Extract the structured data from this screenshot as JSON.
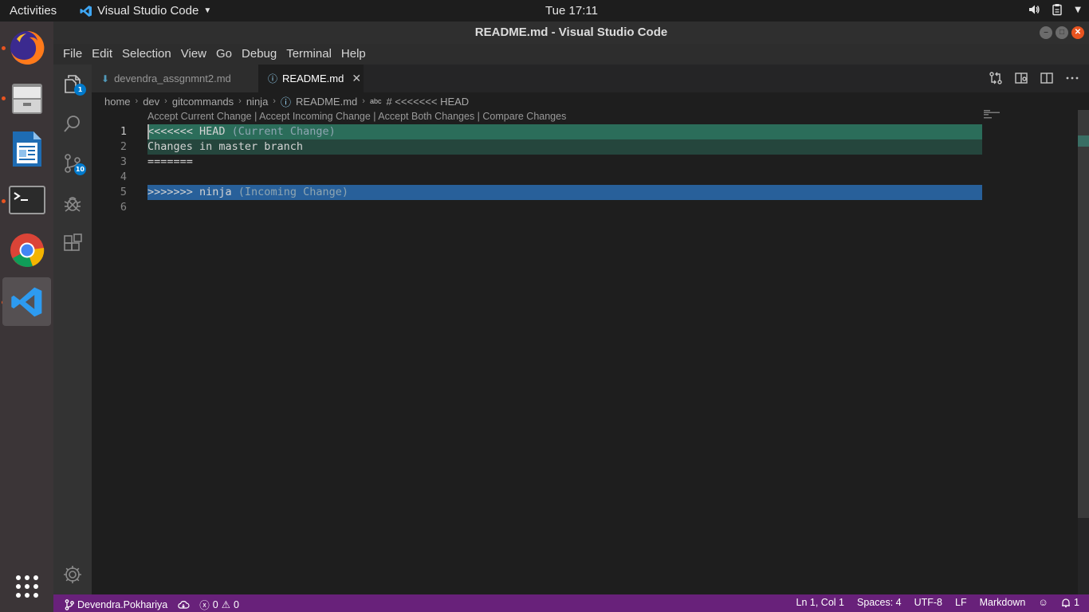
{
  "system": {
    "activities": "Activities",
    "app_name": "Visual Studio Code",
    "clock": "Tue 17:11"
  },
  "window": {
    "title": "README.md - Visual Studio Code"
  },
  "menu": [
    "File",
    "Edit",
    "Selection",
    "View",
    "Go",
    "Debug",
    "Terminal",
    "Help"
  ],
  "activity_bar": {
    "explorer_badge": "1",
    "scm_badge": "10"
  },
  "tabs": [
    {
      "label": "devendra_assgnmnt2.md",
      "active": false
    },
    {
      "label": "README.md",
      "active": true
    }
  ],
  "breadcrumb": [
    "home",
    "dev",
    "gitcommands",
    "ninja",
    "README.md",
    "# <<<<<<< HEAD"
  ],
  "editor": {
    "codelens": "Accept Current Change | Accept Incoming Change | Accept Both Changes | Compare Changes",
    "lines": [
      {
        "number": "1",
        "text": "<<<<<<< HEAD",
        "hint": " (Current Change)"
      },
      {
        "number": "2",
        "text": "Changes in master branch",
        "hint": ""
      },
      {
        "number": "3",
        "text": "=======",
        "hint": ""
      },
      {
        "number": "4",
        "text": "",
        "hint": ""
      },
      {
        "number": "5",
        "text": ">>>>>>> ninja",
        "hint": " (Incoming Change)"
      },
      {
        "number": "6",
        "text": "",
        "hint": ""
      }
    ]
  },
  "status_bar": {
    "branch": "Devendra.Pokhariya",
    "errors": "0",
    "warnings": "0",
    "position": "Ln 1, Col 1",
    "spaces": "Spaces: 4",
    "encoding": "UTF-8",
    "eol": "LF",
    "language": "Markdown",
    "notifications": "1"
  },
  "colors": {
    "status_bar": "#68217a",
    "current_change_header": "#2b6d5a",
    "current_change_body": "#25463d",
    "incoming_change": "#28609a",
    "accent": "#007acc"
  }
}
